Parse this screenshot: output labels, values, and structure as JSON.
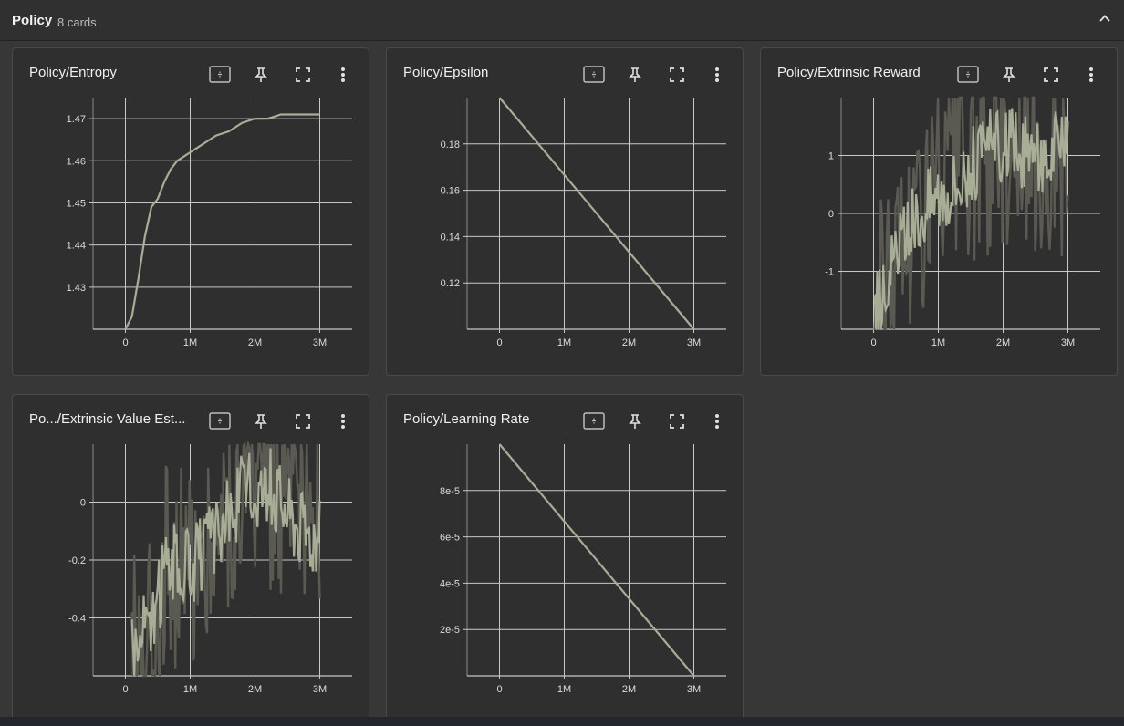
{
  "header": {
    "title": "Policy",
    "count": "8 cards"
  },
  "cards": [
    {
      "title": "Policy/Entropy"
    },
    {
      "title": "Policy/Epsilon"
    },
    {
      "title": "Policy/Extrinsic Reward"
    },
    {
      "title": "Po.../Extrinsic Value Est..."
    },
    {
      "title": "Policy/Learning Rate"
    }
  ],
  "icons": [
    "fit-domain-icon",
    "pin-icon",
    "fullscreen-icon",
    "more-vert-icon"
  ],
  "colors": {
    "line": "#a8ad96",
    "grid": "#c8c8c8",
    "raw": "#5a5a52"
  },
  "chart_data": [
    {
      "type": "line",
      "title": "Policy/Entropy",
      "x_ticks": [
        "0",
        "1M",
        "2M",
        "3M"
      ],
      "y_ticks": [
        "1.43",
        "1.44",
        "1.45",
        "1.46",
        "1.47"
      ],
      "xlim": [
        -500000,
        3500000
      ],
      "ylim": [
        1.42,
        1.475
      ],
      "series": [
        {
          "x": [
            0,
            100000,
            200000,
            300000,
            400000,
            500000,
            600000,
            700000,
            800000,
            900000,
            1000000,
            1200000,
            1400000,
            1600000,
            1800000,
            2000000,
            2200000,
            2400000,
            2600000,
            2800000,
            3000000
          ],
          "y": [
            1.42,
            1.423,
            1.432,
            1.442,
            1.449,
            1.451,
            1.455,
            1.458,
            1.46,
            1.461,
            1.462,
            1.464,
            1.466,
            1.467,
            1.469,
            1.47,
            1.47,
            1.471,
            1.471,
            1.471,
            1.471
          ]
        }
      ]
    },
    {
      "type": "line",
      "title": "Policy/Epsilon",
      "x_ticks": [
        "0",
        "1M",
        "2M",
        "3M"
      ],
      "y_ticks": [
        "0.12",
        "0.14",
        "0.16",
        "0.18"
      ],
      "xlim": [
        -500000,
        3500000
      ],
      "ylim": [
        0.1,
        0.2
      ],
      "series": [
        {
          "x": [
            0,
            3000000
          ],
          "y": [
            0.2,
            0.1
          ]
        }
      ]
    },
    {
      "type": "line",
      "title": "Policy/Extrinsic Reward",
      "x_ticks": [
        "0",
        "1M",
        "2M",
        "3M"
      ],
      "y_ticks": [
        "-1",
        "0",
        "1"
      ],
      "xlim": [
        -500000,
        3500000
      ],
      "ylim": [
        -2,
        2
      ],
      "noisy": true,
      "series": [
        {
          "x": [
            0,
            200000,
            400000,
            600000,
            800000,
            1000000,
            1200000,
            1400000,
            1600000,
            1800000,
            2000000,
            2200000,
            2400000,
            2600000,
            2800000,
            3000000
          ],
          "y": [
            -1.8,
            -1.2,
            -0.6,
            -0.2,
            0.2,
            0.4,
            0.5,
            0.7,
            0.9,
            1.1,
            1.2,
            1.1,
            1.0,
            1.0,
            1.1,
            1.0
          ]
        }
      ]
    },
    {
      "type": "line",
      "title": "Po.../Extrinsic Value Est...",
      "x_ticks": [
        "0",
        "1M",
        "2M",
        "3M"
      ],
      "y_ticks": [
        "-0.4",
        "-0.2",
        "0"
      ],
      "xlim": [
        -500000,
        3500000
      ],
      "ylim": [
        -0.6,
        0.2
      ],
      "noisy": true,
      "series": [
        {
          "x": [
            100000,
            200000,
            300000,
            400000,
            500000,
            600000,
            700000,
            800000,
            900000,
            1000000,
            1200000,
            1400000,
            1600000,
            1800000,
            2000000,
            2200000,
            2400000,
            2600000,
            2800000,
            3000000
          ],
          "y": [
            -0.45,
            -0.52,
            -0.4,
            -0.48,
            -0.34,
            -0.22,
            -0.18,
            -0.23,
            -0.21,
            -0.22,
            -0.17,
            -0.12,
            -0.04,
            0.03,
            0.05,
            0.06,
            0.02,
            -0.05,
            -0.09,
            -0.12
          ]
        }
      ]
    },
    {
      "type": "line",
      "title": "Policy/Learning Rate",
      "x_ticks": [
        "0",
        "1M",
        "2M",
        "3M"
      ],
      "y_ticks": [
        "2e-5",
        "4e-5",
        "6e-5",
        "8e-5"
      ],
      "xlim": [
        -500000,
        3500000
      ],
      "ylim": [
        0,
        0.0001
      ],
      "series": [
        {
          "x": [
            0,
            3000000
          ],
          "y": [
            0.0001,
            0
          ]
        }
      ]
    }
  ]
}
